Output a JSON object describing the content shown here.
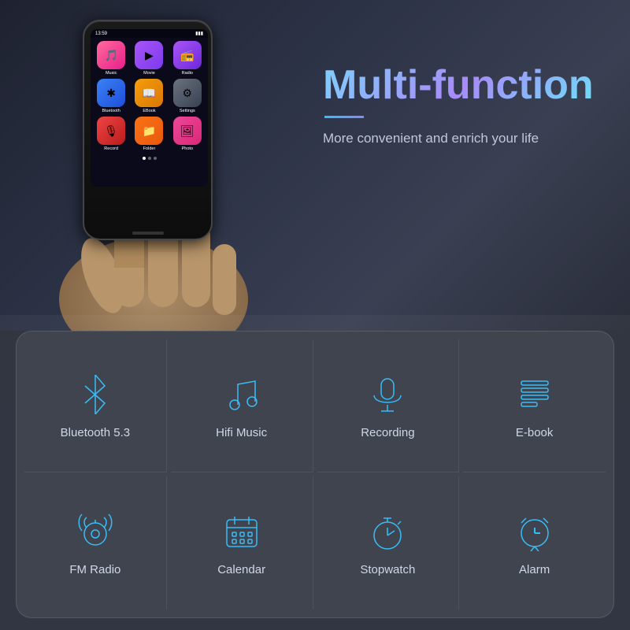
{
  "hero": {
    "title": "Multi-function",
    "subtitle": "More convenient and enrich your life"
  },
  "device": {
    "time": "13:59",
    "apps": [
      {
        "label": "Music",
        "class": "app-music",
        "icon": "🎵"
      },
      {
        "label": "Movie",
        "class": "app-movie",
        "icon": "▶"
      },
      {
        "label": "Radio",
        "class": "app-radio",
        "icon": "📻"
      },
      {
        "label": "Bluetooth",
        "class": "app-bluetooth",
        "icon": "✱"
      },
      {
        "label": "EBook",
        "class": "app-ebook",
        "icon": "📖"
      },
      {
        "label": "Settings",
        "class": "app-settings",
        "icon": "⚙"
      },
      {
        "label": "Record",
        "class": "app-record",
        "icon": "🎙"
      },
      {
        "label": "Folder",
        "class": "app-folder",
        "icon": "📁"
      },
      {
        "label": "Photo",
        "class": "app-photo",
        "icon": "🖼"
      }
    ]
  },
  "features": [
    {
      "id": "bluetooth",
      "label": "Bluetooth 5.3",
      "icon": "bluetooth"
    },
    {
      "id": "hifi-music",
      "label": "Hifi Music",
      "icon": "music-note"
    },
    {
      "id": "recording",
      "label": "Recording",
      "icon": "microphone"
    },
    {
      "id": "ebook",
      "label": "E-book",
      "icon": "ebook"
    },
    {
      "id": "fm-radio",
      "label": "FM Radio",
      "icon": "radio"
    },
    {
      "id": "calendar",
      "label": "Calendar",
      "icon": "calendar"
    },
    {
      "id": "stopwatch",
      "label": "Stopwatch",
      "icon": "stopwatch"
    },
    {
      "id": "alarm",
      "label": "Alarm",
      "icon": "alarm"
    }
  ]
}
